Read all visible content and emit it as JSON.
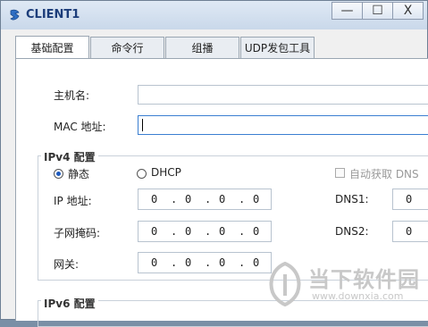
{
  "window": {
    "title": "CLIENT1",
    "minimize": "—",
    "maximize": "☐",
    "close": "X"
  },
  "tabs": [
    {
      "label": "基础配置",
      "active": true
    },
    {
      "label": "命令行",
      "active": false
    },
    {
      "label": "组播",
      "active": false
    },
    {
      "label": "UDP发包工具",
      "active": false
    }
  ],
  "form": {
    "hostname_label": "主机名:",
    "hostname_value": "",
    "mac_label": "MAC 地址:",
    "mac_value": ""
  },
  "ipv4": {
    "group_title": "IPv4 配置",
    "static_label": "静态",
    "static_selected": true,
    "dhcp_label": "DHCP",
    "dhcp_selected": false,
    "auto_dns_label": "自动获取 DNS",
    "ip_label": "IP 地址:",
    "ip": [
      "0",
      "0",
      "0",
      "0"
    ],
    "mask_label": "子网掩码:",
    "mask": [
      "0",
      "0",
      "0",
      "0"
    ],
    "gateway_label": "网关:",
    "gateway": [
      "0",
      "0",
      "0",
      "0"
    ],
    "dns1_label": "DNS1:",
    "dns2_label": "DNS2:",
    "dns_first_octet": "0"
  },
  "ipv6": {
    "group_title": "IPv6 配置"
  },
  "watermark": {
    "text": "当下软件园",
    "url": "www.downxia.com"
  }
}
